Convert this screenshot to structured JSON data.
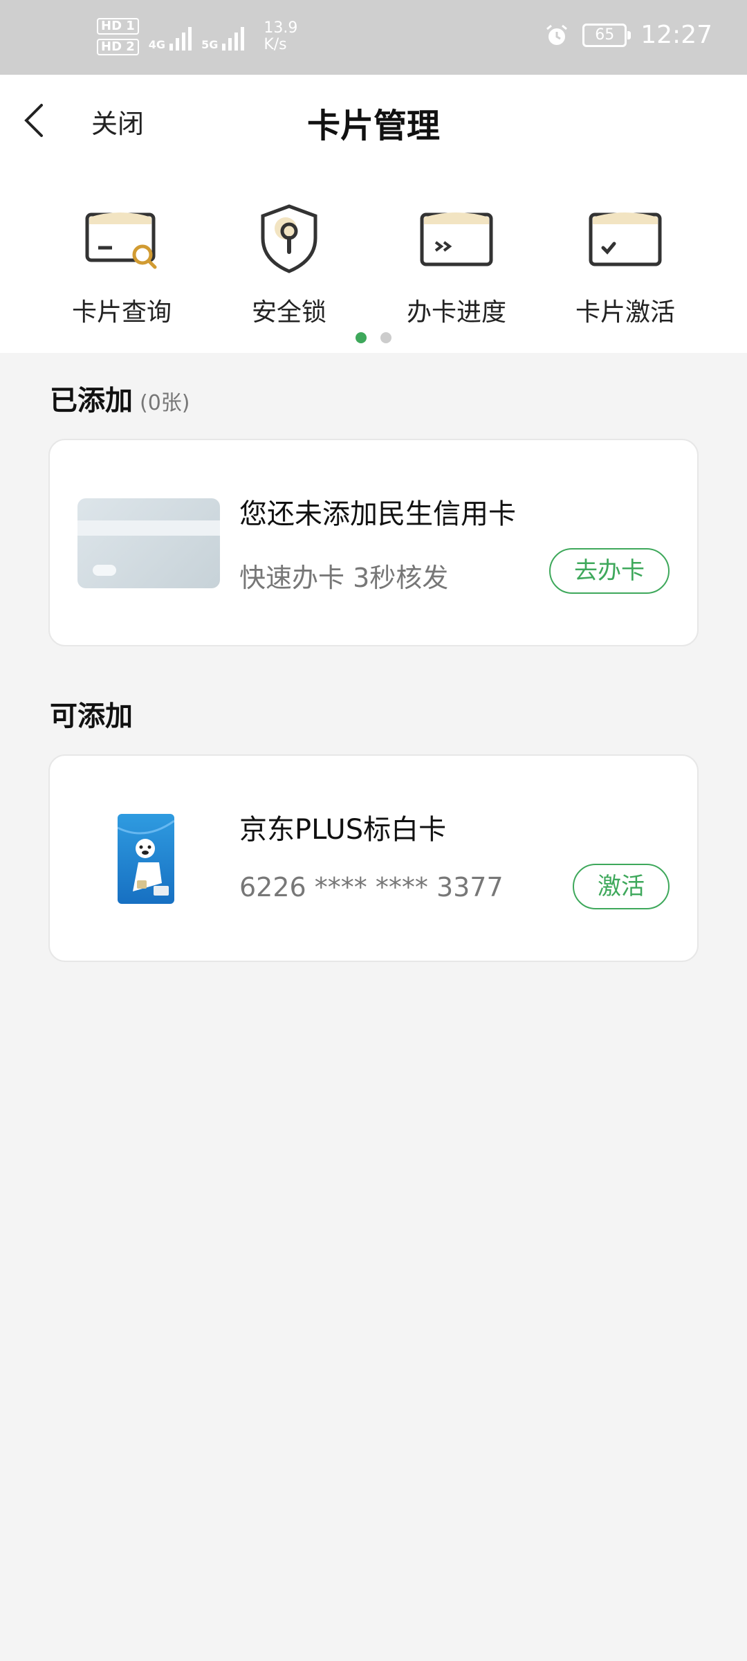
{
  "status_bar": {
    "hd1": "HD 1",
    "hd2": "HD 2",
    "net1": "4G",
    "net2": "5G",
    "speed_value": "13.9",
    "speed_unit": "K/s",
    "battery": "65",
    "time": "12:27"
  },
  "header": {
    "close_label": "关闭",
    "title": "卡片管理"
  },
  "quick_menu": {
    "items": [
      {
        "label": "卡片查询",
        "icon": "card-search-icon"
      },
      {
        "label": "安全锁",
        "icon": "security-lock-icon"
      },
      {
        "label": "办卡进度",
        "icon": "application-progress-icon"
      },
      {
        "label": "卡片激活",
        "icon": "card-activate-icon"
      }
    ],
    "page_count": 2,
    "active_page": 1
  },
  "added": {
    "title": "已添加",
    "count": "(0张)",
    "empty_title": "您还未添加民生信用卡",
    "empty_subtitle": "快速办卡 3秒核发",
    "button": "去办卡"
  },
  "addable": {
    "title": "可添加",
    "card_name": "京东PLUS标白卡",
    "card_number": "6226 **** **** 3377",
    "button": "激活"
  },
  "colors": {
    "accent": "#3ea85b",
    "statusbar": "#cfcfcf",
    "background": "#f4f4f4"
  }
}
